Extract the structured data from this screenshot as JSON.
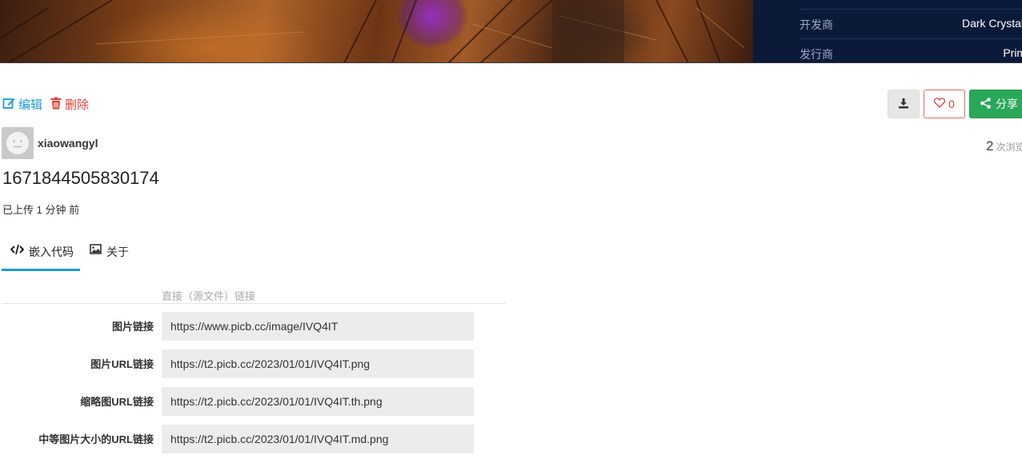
{
  "banner": {
    "game_info": [
      {
        "key": "开发商",
        "value": "Dark Crystal Game"
      },
      {
        "key": "发行商",
        "value": "Prime Matt"
      }
    ]
  },
  "actions": {
    "edit_label": "编辑",
    "delete_label": "删除"
  },
  "buttons": {
    "like_count": "0",
    "share_label": "分享"
  },
  "user": {
    "username": "xiaowangyl"
  },
  "stats": {
    "views_count": "2",
    "views_label": "次浏览"
  },
  "image": {
    "title": "1671844505830174",
    "uploaded": "已上传 1 分钟 前"
  },
  "tabs": [
    {
      "label": "嵌入代码"
    },
    {
      "label": "关于"
    }
  ],
  "links": {
    "section_label": "直接（源文件）链接",
    "fields": [
      {
        "label": "图片链接",
        "value": "https://www.picb.cc/image/IVQ4IT"
      },
      {
        "label": "图片URL链接",
        "value": "https://t2.picb.cc/2023/01/01/IVQ4IT.png"
      },
      {
        "label": "缩略图URL链接",
        "value": "https://t2.picb.cc/2023/01/01/IVQ4IT.th.png"
      },
      {
        "label": "中等图片大小的URL链接",
        "value": "https://t2.picb.cc/2023/01/01/IVQ4IT.md.png"
      }
    ]
  },
  "colors": {
    "accent": "#1c9cd6",
    "danger": "#e0403a",
    "success": "#2aa85a",
    "info_panel": "#0c1a3a"
  }
}
